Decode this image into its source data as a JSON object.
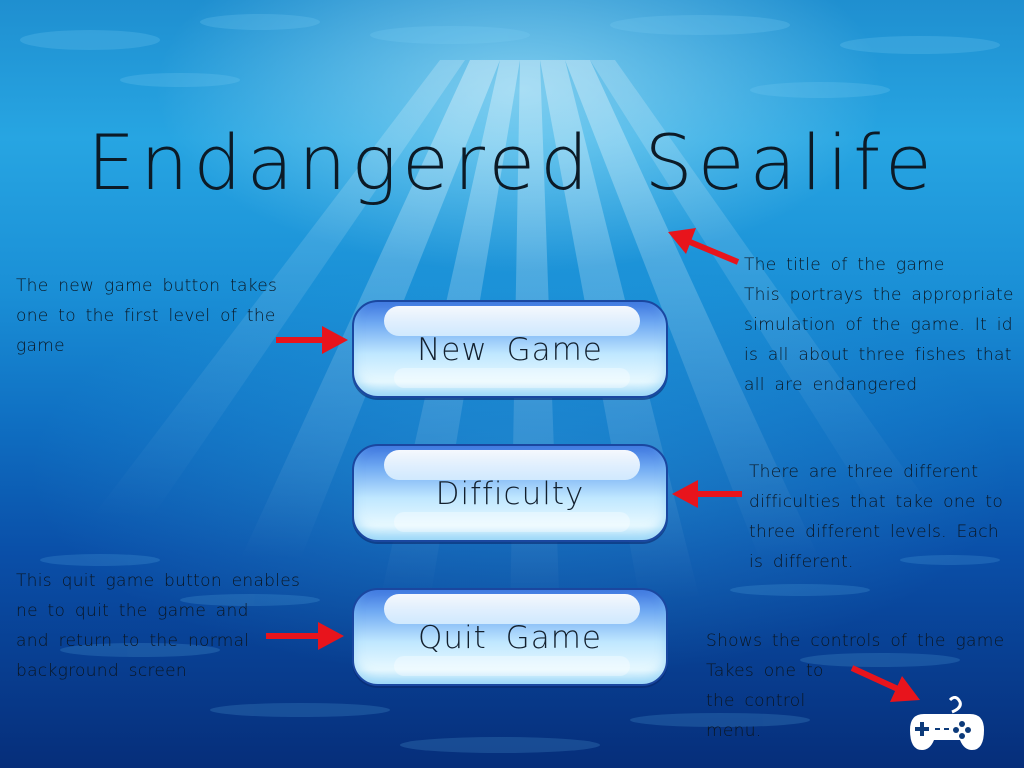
{
  "title": "Endangered Sealife",
  "menu": {
    "new_game": "New Game",
    "difficulty": "Difficulty",
    "quit_game": "Quit Game"
  },
  "notes": {
    "title_note": [
      "The title of the game",
      "This portrays the appropriate",
      "simulation of the game. It id",
      "is all about three fishes that",
      "all are endangered"
    ],
    "new_game_note": [
      "The new game button takes",
      "one to the first level of the",
      "game"
    ],
    "difficulty_note": [
      "There are three different",
      "difficulties that take one to",
      "three different levels. Each",
      "is different."
    ],
    "quit_note": [
      "This quit game button enables",
      "ne to quit the game and",
      "and return to the normal",
      "background screen"
    ],
    "controls_note": [
      "Shows the controls of the game",
      "Takes one to",
      "the control",
      "menu."
    ]
  },
  "icons": {
    "controller": "gamepad-icon",
    "arrow": "red-arrow-icon"
  },
  "colors": {
    "arrow": "#e8141c",
    "text": "#0c1a26",
    "button_border": "#1a47a0"
  }
}
